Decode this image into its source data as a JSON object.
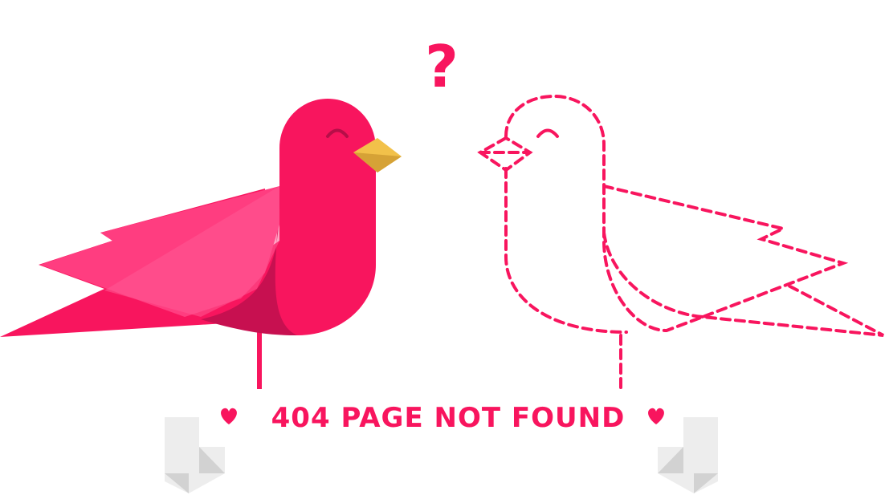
{
  "question_mark": "?",
  "banner": {
    "text": "404 PAGE NOT FOUND"
  },
  "colors": {
    "primary": "#F8155E",
    "wing_light": "#FF3D80",
    "wing_lighter": "#FF5A93",
    "belly_shadow": "#C71050",
    "beak": "#F2C14A",
    "beak_shadow": "#D6A236",
    "eye": "#B60E48",
    "ribbon_light": "#EDEDED",
    "ribbon_dark": "#C9C9C9",
    "background": "#FFFFFF"
  },
  "icons": {
    "left_heart": "heart-icon",
    "right_heart": "heart-icon"
  }
}
